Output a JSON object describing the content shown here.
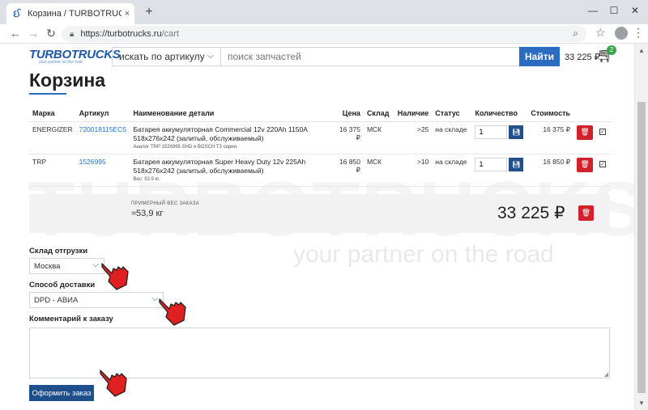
{
  "browser": {
    "tab_title": "Корзина / TURBOTRUCKS — за:",
    "tab_close": "×",
    "new_tab": "+",
    "url_host": "https://turbotrucks.ru",
    "url_path": "/cart",
    "win_min": "—",
    "win_max": "☐",
    "win_close": "✕"
  },
  "header": {
    "logo": "TURBOTRUCKS",
    "logo_sub": "your partner on the road",
    "search_type": "искать по артикулу",
    "search_placeholder": "поиск запчастей",
    "search_button": "Найти",
    "cart_total": "33 225 ₽",
    "cart_count": "2"
  },
  "page": {
    "title": "Корзина"
  },
  "table": {
    "headers": {
      "brand": "Марка",
      "article": "Артикул",
      "name": "Наименование детали",
      "price": "Цена",
      "stock": "Склад",
      "availability": "Наличие",
      "status": "Статус",
      "qty": "Количество",
      "cost": "Стоимость"
    },
    "rows": [
      {
        "brand": "ENERGIZER",
        "article": "720018115EC5",
        "name": "Батарея аккумуляторная Commercial 12v 220Ah 1150A 518x276x242 (залитый, обслуживаемый)",
        "note": "Аналог TRP 1526995 SHD и BOSCH T3 серии.",
        "price": "16 375 ₽",
        "stock": "МСК",
        "availability": ">25",
        "status": "на складе",
        "qty": "1",
        "cost": "16 375 ₽"
      },
      {
        "brand": "TRP",
        "article": "1526995",
        "name": "Батарея аккумуляторная Super Heavy Duty 12v 225Ah 518x276x242 (залитый, обслуживаемый)",
        "note": "Вес: 53.9 кг.",
        "price": "16 850 ₽",
        "stock": "МСК",
        "availability": ">10",
        "status": "на складе",
        "qty": "1",
        "cost": "16 850 ₽"
      }
    ]
  },
  "summary": {
    "weight_label": "ПРИМЕРНЫЙ ВЕС ЗАКАЗА",
    "weight_value": "≈53,9 кг",
    "total": "33 225 ₽"
  },
  "form": {
    "warehouse_label": "Склад отгрузки",
    "warehouse_value": "Москва",
    "delivery_label": "Способ доставки",
    "delivery_value": "DPD - АВИА",
    "comment_label": "Комментарий к заказу",
    "comment_value": "",
    "submit": "Оформить заказ"
  },
  "watermark": {
    "main": "TURBOTRUCKS",
    "sub": "your partner on the road"
  },
  "colors": {
    "brand_blue": "#2b6cc1",
    "dark_blue": "#1f4e8c",
    "danger_red": "#d32129",
    "badge_green": "#38a54a"
  }
}
